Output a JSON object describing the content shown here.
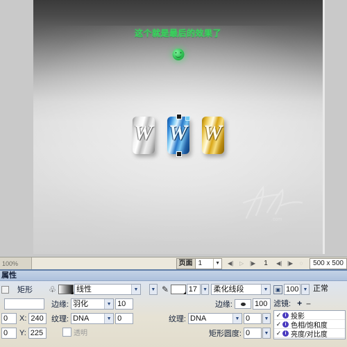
{
  "canvas": {
    "headline": "这个就是最后的效果了",
    "smiley_icon": "smiley-face-icon",
    "objects": [
      {
        "name": "silver-logo",
        "glyph": "W",
        "material": "silver",
        "selected": false
      },
      {
        "name": "blue-logo",
        "glyph": "W",
        "material": "blue",
        "selected": true
      },
      {
        "name": "gold-logo",
        "glyph": "W",
        "material": "gold",
        "selected": false
      }
    ],
    "watermark": "signature-watermark",
    "colors": {
      "headline_green": "#37d45c",
      "canvas_top": "#3a3a3a",
      "canvas_bottom": "#cfcfcf"
    }
  },
  "statusbar": {
    "zoom_label": "100%",
    "page_label": "页面",
    "page_value": "1",
    "first_frame_icon": "first-frame-icon",
    "play_icon": "play-icon",
    "last_frame_icon": "last-frame-icon",
    "frame_number": "1",
    "prev_page_icon": "previous-page-icon",
    "next_page_icon": "next-page-icon",
    "stop_icon": "stop-icon",
    "dimensions": "500 x 500"
  },
  "properties": {
    "title": "属性",
    "object": {
      "type_label": "矩形",
      "name_value": "",
      "x_label": "X:",
      "x_value": "240",
      "y_label": "Y:",
      "y_value": "225",
      "w_value": "0",
      "h_value": "0"
    },
    "fill": {
      "bucket_icon": "paint-bucket-icon",
      "swatch": "gradient-swatch",
      "type": "线性",
      "edge_label": "边缘:",
      "edge_type": "羽化",
      "edge_amount": "10",
      "texture_label": "纹理:",
      "texture_name": "DNA",
      "texture_amount": "0",
      "transparent_label": "透明"
    },
    "stroke": {
      "pencil_icon": "pencil-icon",
      "swatch": "stroke-color-swatch",
      "size": "17",
      "type": "柔化线段",
      "edge_label": "边缘:",
      "edge_amount": "100",
      "texture_label": "纹理:",
      "texture_name": "DNA",
      "texture_amount": "0",
      "roundness_label": "矩形圆度:",
      "roundness_value": "0"
    },
    "effects": {
      "opacity_icon": "opacity-icon",
      "opacity_value": "100",
      "blend_mode": "正常",
      "filters_label": "滤镜:",
      "add_icon": "plus-icon",
      "remove_icon": "minus-icon",
      "filters": [
        {
          "enabled": "✓",
          "badge": "i",
          "name": "投影"
        },
        {
          "enabled": "✓",
          "badge": "i",
          "name": "色相/饱和度"
        },
        {
          "enabled": "✓",
          "badge": "i",
          "name": "亮度/对比度"
        }
      ]
    }
  }
}
